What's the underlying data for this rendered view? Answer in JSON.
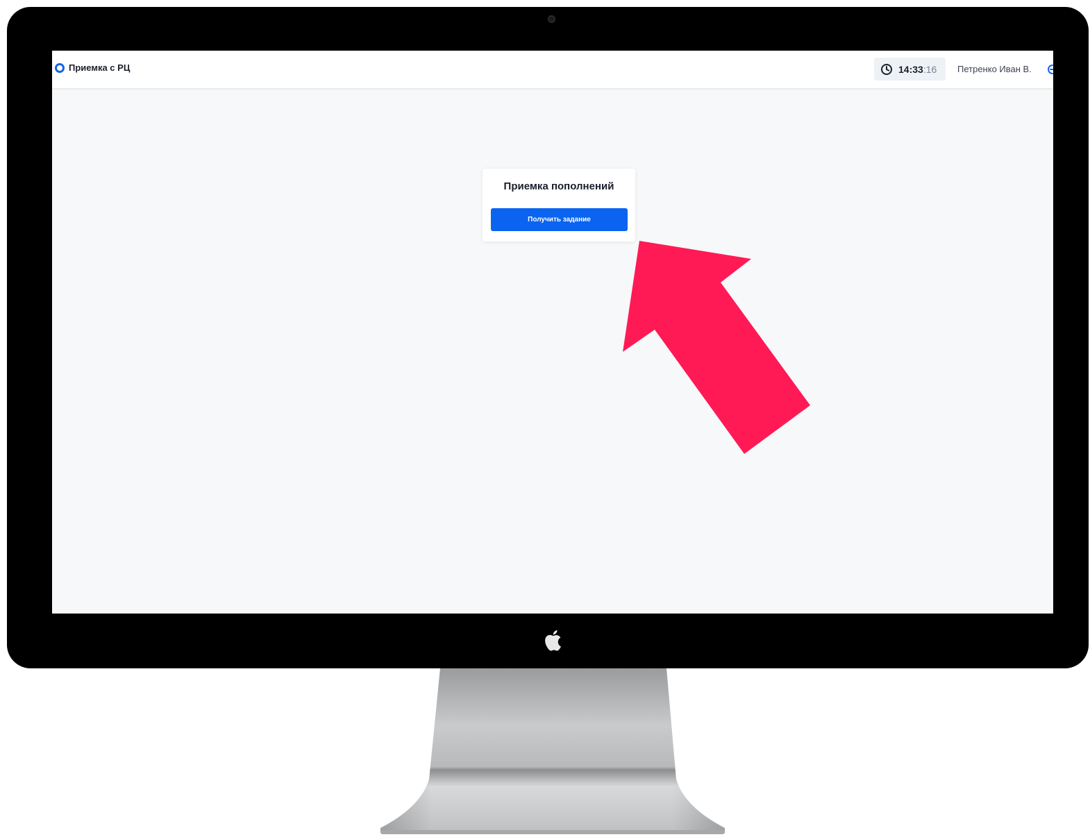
{
  "header": {
    "app_title": "Приемка с РЦ",
    "clock_hm": "14:33",
    "clock_sec": ":16",
    "user_name": "Петренко Иван В."
  },
  "card": {
    "title": "Приемка пополнений",
    "button_label": "Получить задание"
  },
  "icons": {
    "brand": "ring-icon",
    "clock": "clock-icon",
    "logout": "logout-icon",
    "bezel_logo": "apple-logo-icon",
    "annotation": "arrow-annotation"
  },
  "colors": {
    "accent": "#0a64f0",
    "brand_ring": "#1565e6",
    "annotation_arrow": "#ff1a55",
    "screen_background": "#f6f8fa"
  }
}
